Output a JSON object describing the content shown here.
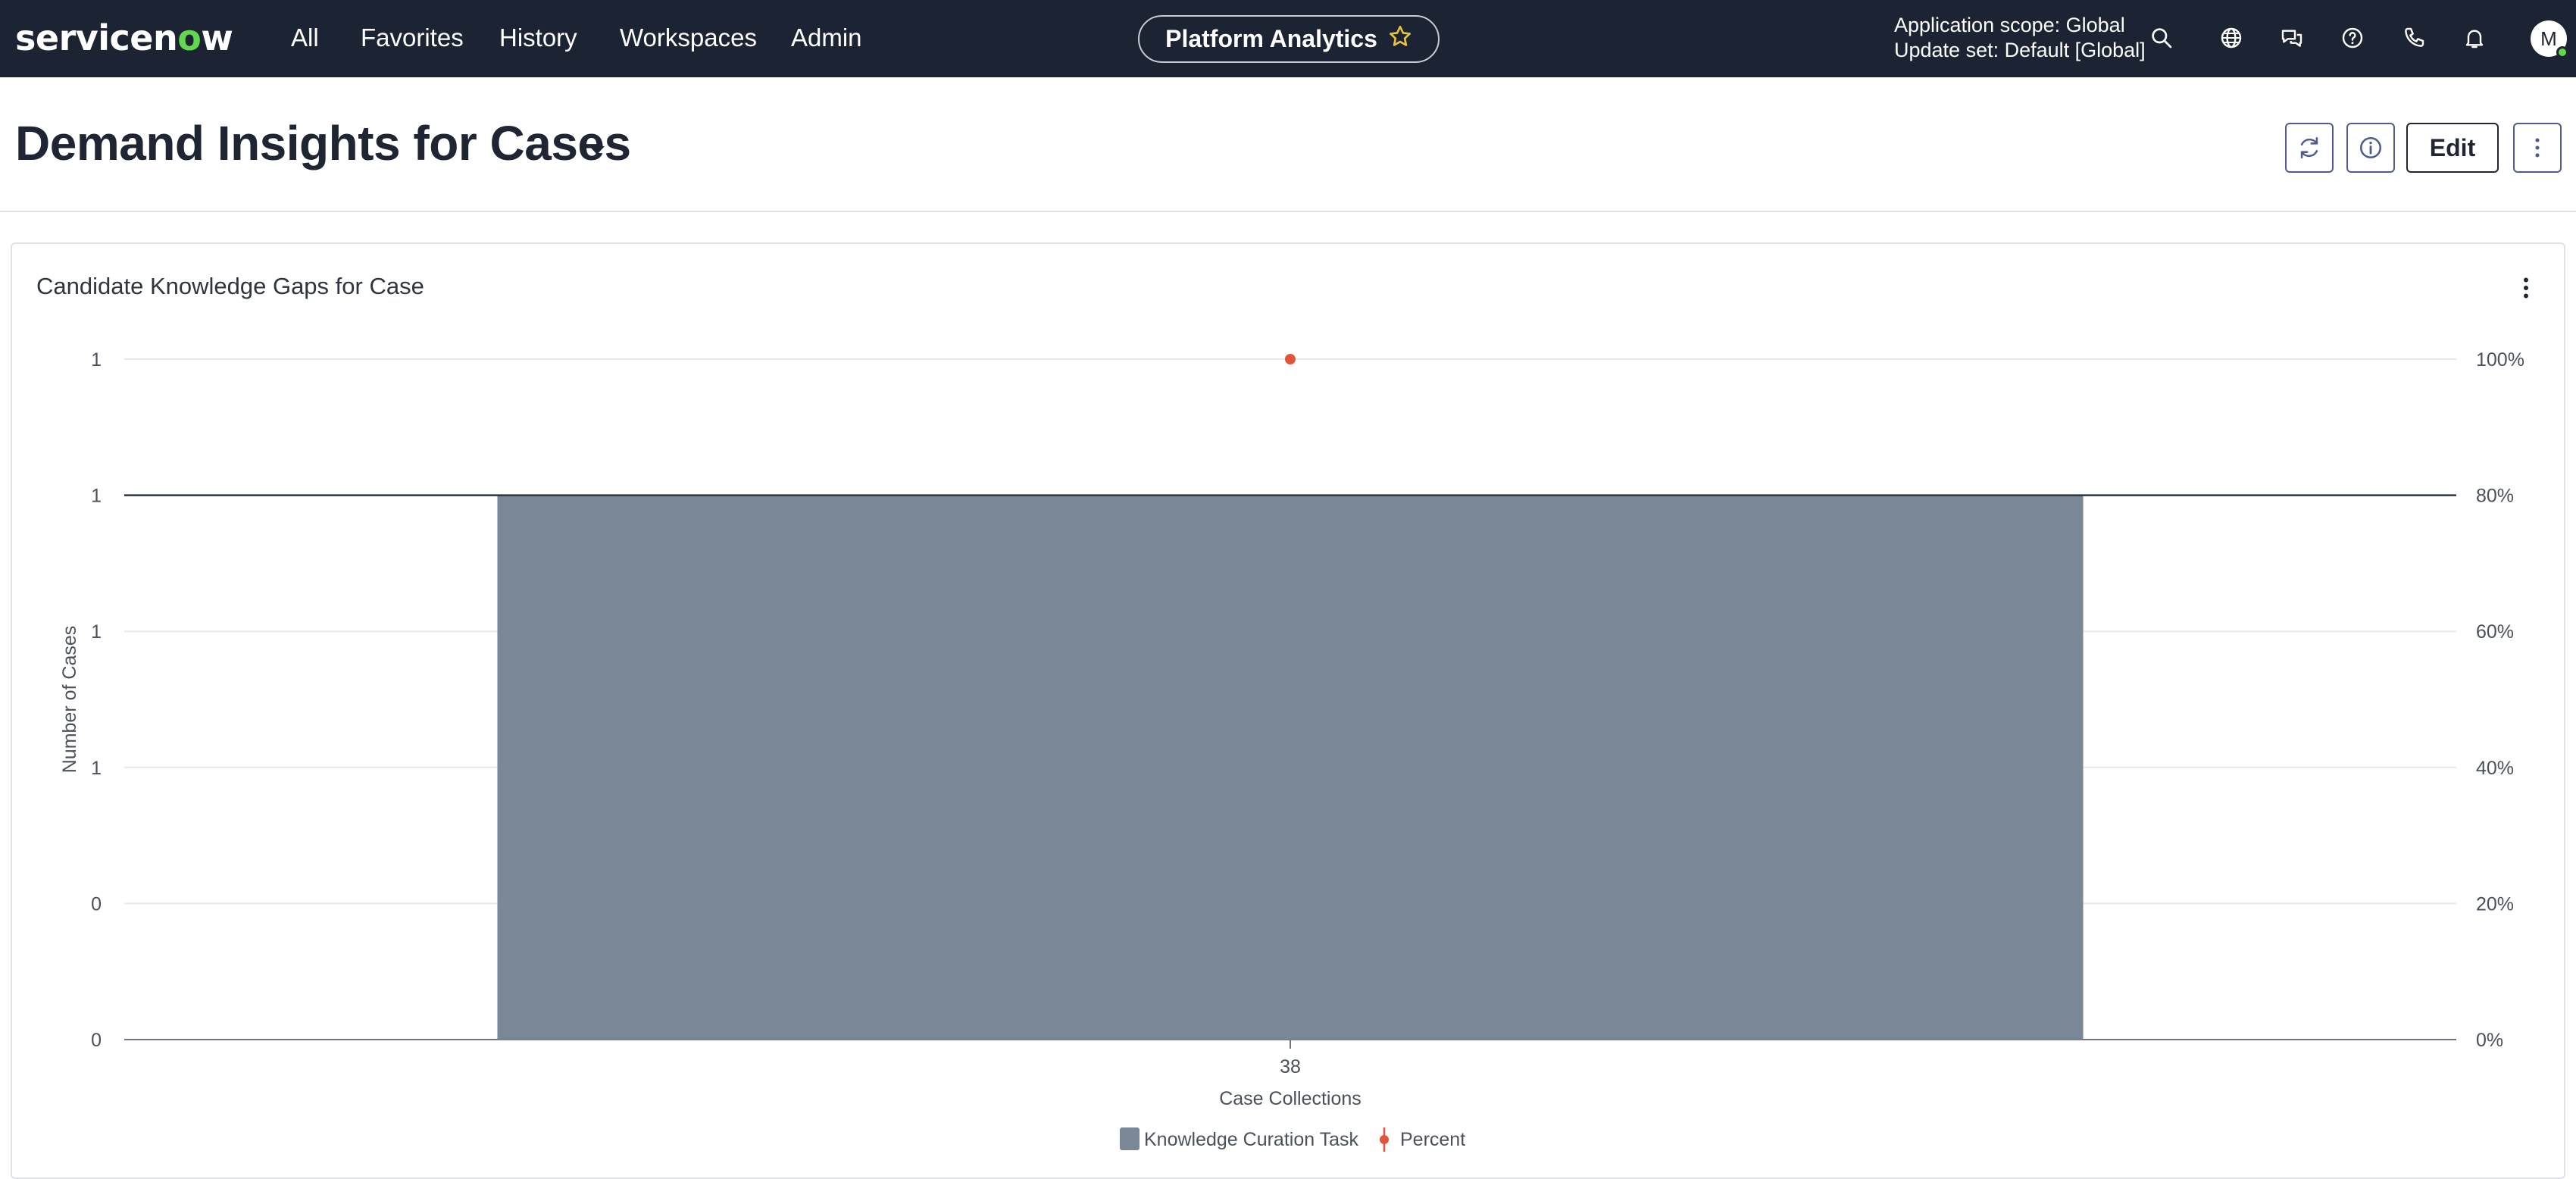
{
  "nav": {
    "logo": {
      "prefix": "servicen",
      "o": "o",
      "suffix": "w"
    },
    "links": [
      "All",
      "Favorites",
      "History",
      "Workspaces",
      "Admin"
    ],
    "center_pill": "Platform Analytics",
    "scope_line1": "Application scope: Global",
    "scope_line2": "Update set: Default [Global]",
    "avatar_initial": "M"
  },
  "page": {
    "title": "Demand Insights for Cases",
    "edit_label": "Edit"
  },
  "card": {
    "title": "Candidate Knowledge Gaps for Case"
  },
  "chart_data": {
    "type": "bar",
    "categories": [
      "38"
    ],
    "xlabel": "Case Collections",
    "ylabel": "Number of Cases",
    "y_left_ticks": [
      "0",
      "0",
      "1",
      "1",
      "1",
      "1"
    ],
    "y_right_ticks": [
      "0%",
      "20%",
      "40%",
      "60%",
      "80%",
      "100%"
    ],
    "ylim": [
      0,
      1.25
    ],
    "y2lim": [
      0,
      100
    ],
    "grid": true,
    "legend_position": "bottom",
    "series": [
      {
        "name": "Knowledge Curation Task",
        "kind": "bar",
        "values": [
          1
        ],
        "color": "#7a8797"
      },
      {
        "name": "Percent",
        "kind": "line",
        "axis": "right",
        "values": [
          100
        ],
        "color": "#e2553a"
      }
    ]
  }
}
